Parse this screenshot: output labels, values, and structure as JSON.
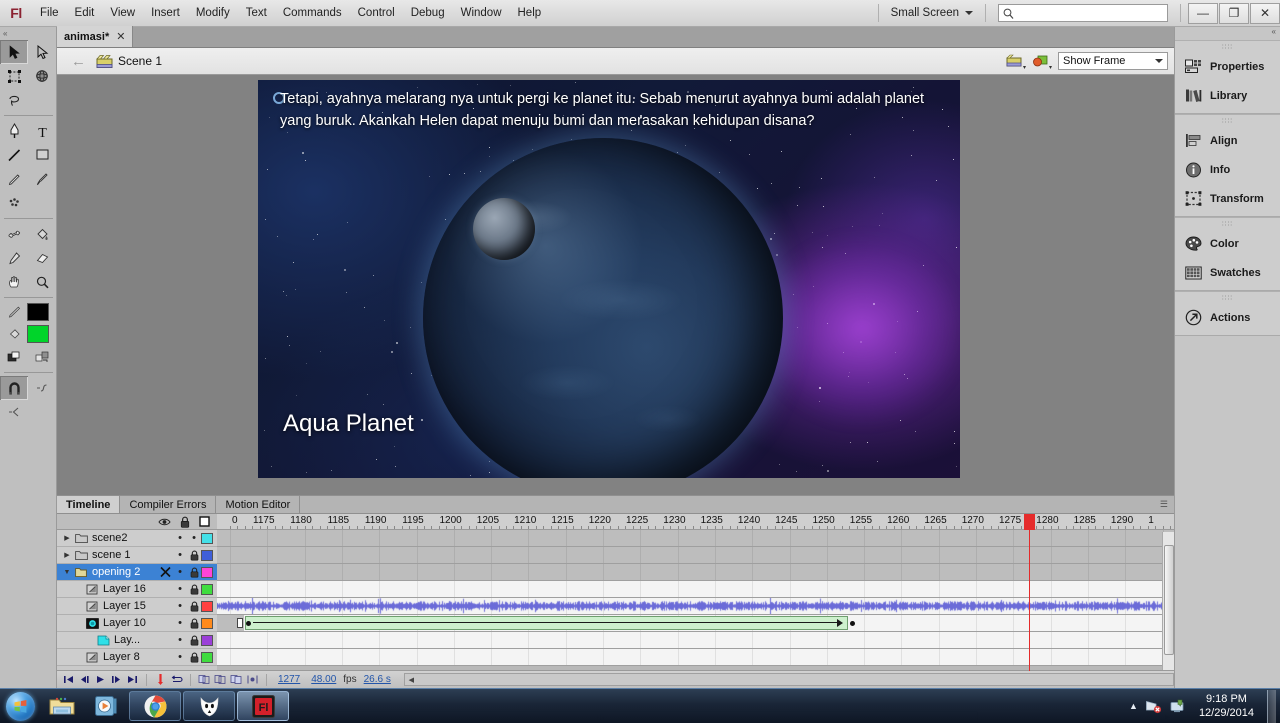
{
  "app": {
    "logo": "Fl",
    "title": "Adobe Flash Professional"
  },
  "menubar": {
    "items": [
      "File",
      "Edit",
      "View",
      "Insert",
      "Modify",
      "Text",
      "Commands",
      "Control",
      "Debug",
      "Window",
      "Help"
    ],
    "workspace": "Small Screen",
    "search_placeholder": "",
    "search_value": "",
    "window_buttons": {
      "minimize": "—",
      "restore": "❐",
      "close": "✕"
    }
  },
  "toolbar": {
    "tools": [
      {
        "name": "selection-tool",
        "selected": true
      },
      {
        "name": "subselection-tool",
        "selected": false
      },
      {
        "name": "free-transform-tool",
        "selected": false
      },
      {
        "name": "3d-rotation-tool",
        "selected": false
      },
      {
        "name": "lasso-tool",
        "selected": false
      },
      {
        "name": "pen-tool",
        "selected": false
      },
      {
        "name": "text-tool",
        "selected": false
      },
      {
        "name": "line-tool",
        "selected": false
      },
      {
        "name": "rectangle-tool",
        "selected": false
      },
      {
        "name": "pencil-tool",
        "selected": false
      },
      {
        "name": "brush-tool",
        "selected": false
      },
      {
        "name": "deco-tool",
        "selected": false
      },
      {
        "name": "bone-tool",
        "selected": false
      },
      {
        "name": "paint-bucket-tool",
        "selected": false
      },
      {
        "name": "eyedropper-tool",
        "selected": false
      },
      {
        "name": "eraser-tool",
        "selected": false
      },
      {
        "name": "hand-tool",
        "selected": false
      },
      {
        "name": "zoom-tool",
        "selected": false
      }
    ],
    "stroke_color": "#000000",
    "fill_color": "#00d42a",
    "snap_enabled": true
  },
  "document": {
    "tab_label": "animasi*",
    "tab_close": "✕",
    "scene_label": "Scene 1",
    "zoom_value": "Show Frame"
  },
  "stage": {
    "narration": "Tetapi, ayahnya melarang nya untuk pergi ke planet itu. Sebab menurut ayahnya bumi adalah planet yang buruk. Akankah Helen dapat menuju bumi dan merasakan kehidupan disana?",
    "title_text": "Aqua Planet"
  },
  "panels": {
    "collapse_icon": "«",
    "groups": [
      {
        "items": [
          {
            "label": "Properties",
            "icon": "properties-icon"
          },
          {
            "label": "Library",
            "icon": "library-icon"
          }
        ]
      },
      {
        "items": [
          {
            "label": "Align",
            "icon": "align-icon"
          },
          {
            "label": "Info",
            "icon": "info-icon"
          },
          {
            "label": "Transform",
            "icon": "transform-icon"
          }
        ]
      },
      {
        "items": [
          {
            "label": "Color",
            "icon": "color-icon"
          },
          {
            "label": "Swatches",
            "icon": "swatches-icon"
          }
        ]
      },
      {
        "items": [
          {
            "label": "Actions",
            "icon": "actions-icon"
          }
        ]
      }
    ]
  },
  "timeline": {
    "tabs": [
      {
        "label": "Timeline",
        "active": true
      },
      {
        "label": "Compiler Errors",
        "active": false
      },
      {
        "label": "Motion Editor",
        "active": false
      }
    ],
    "header_icons": {
      "eye": "eye-icon",
      "lock": "lock-icon",
      "outline": "outline-icon"
    },
    "ruler_origin_label": "0",
    "ruler_labels": [
      "1175",
      "1180",
      "1185",
      "1190",
      "1195",
      "1200",
      "1205",
      "1210",
      "1215",
      "1220",
      "1225",
      "1230",
      "1235",
      "1240",
      "1245",
      "1250",
      "1255",
      "1260",
      "1265",
      "1270",
      "1275",
      "1280",
      "1285",
      "1290",
      "1"
    ],
    "playhead_frame": "1275",
    "layers": [
      {
        "name": "scene2",
        "type": "folder",
        "expanded": false,
        "indent": 0,
        "selected": false,
        "visible_dot": "•",
        "locked": false,
        "color": "#44e0e8"
      },
      {
        "name": "scene 1",
        "type": "folder",
        "expanded": false,
        "indent": 0,
        "selected": false,
        "visible_dot": "•",
        "locked": true,
        "color": "#3f5fd8"
      },
      {
        "name": "opening 2",
        "type": "folder-open",
        "expanded": true,
        "indent": 0,
        "selected": true,
        "visible_dot": "•",
        "locked": true,
        "color": "#ff44d8"
      },
      {
        "name": "Layer 16",
        "type": "layer",
        "expanded": false,
        "indent": 1,
        "selected": false,
        "visible_dot": "•",
        "locked": true,
        "color": "#3fdc3f"
      },
      {
        "name": "Layer 15",
        "type": "layer",
        "expanded": false,
        "indent": 1,
        "selected": false,
        "visible_dot": "•",
        "locked": true,
        "color": "#ff4040"
      },
      {
        "name": "Layer 10",
        "type": "movieclip",
        "expanded": false,
        "indent": 1,
        "selected": false,
        "visible_dot": "•",
        "locked": true,
        "color": "#ff8a1c"
      },
      {
        "name": "Lay...",
        "type": "guide",
        "expanded": false,
        "indent": 2,
        "selected": false,
        "visible_dot": "•",
        "locked": true,
        "color": "#9b3fd8"
      },
      {
        "name": "Layer 8",
        "type": "layer",
        "expanded": false,
        "indent": 1,
        "selected": false,
        "visible_dot": "•",
        "locked": true,
        "color": "#3fdc3f"
      }
    ],
    "footer": {
      "buttons": [
        "first-frame",
        "step-back",
        "play",
        "step-forward",
        "last-frame",
        "center-playhead",
        "loop",
        "onion-skin",
        "onion-skin-outlines",
        "edit-multiple-frames",
        "modify-markers"
      ],
      "current_frame": "1277",
      "fps": "48.00",
      "fps_label": "fps",
      "elapsed": "26.6 s"
    }
  },
  "taskbar": {
    "start_label": "Start",
    "pinned": [
      {
        "name": "file-explorer-icon"
      },
      {
        "name": "media-player-icon"
      }
    ],
    "running": [
      {
        "name": "chrome-icon",
        "active": false
      },
      {
        "name": "foobar-icon",
        "active": false
      },
      {
        "name": "flash-icon",
        "active": true
      }
    ],
    "tray_icons": [
      "show-hidden-icon",
      "network-icon",
      "action-center-icon"
    ],
    "clock_time": "9:18 PM",
    "clock_date": "12/29/2014"
  }
}
